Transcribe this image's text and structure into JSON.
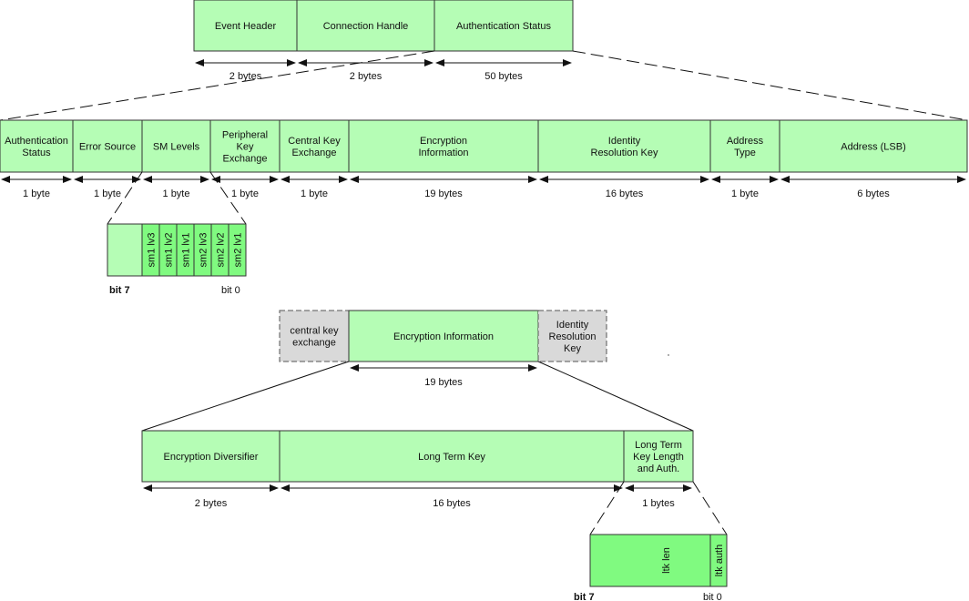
{
  "colors": {
    "field": "#b5fdb5",
    "bit_field": "#80fa80",
    "context_field": "#d9d9d9",
    "line": "#111111"
  },
  "event_packet": {
    "fields": [
      {
        "label": "Event Header",
        "size": "2 bytes"
      },
      {
        "label": "Connection Handle",
        "size": "2 bytes"
      },
      {
        "label": "Authentication Status",
        "size": "50 bytes"
      }
    ]
  },
  "authentication_status": {
    "fields": [
      {
        "label": "Authentication\nStatus",
        "size": "1 byte"
      },
      {
        "label": "Error Source",
        "size": "1 byte"
      },
      {
        "label": "SM Levels",
        "size": "1 byte"
      },
      {
        "label": "Peripheral\nKey\nExchange",
        "size": "1 byte"
      },
      {
        "label": "Central Key\nExchange",
        "size": "1 byte"
      },
      {
        "label": "Encryption\nInformation",
        "size": "19 bytes"
      },
      {
        "label": "Identity\nResolution Key",
        "size": "16 bytes"
      },
      {
        "label": "Address\nType",
        "size": "1 byte"
      },
      {
        "label": "Address (LSB)",
        "size": "6 bytes"
      }
    ]
  },
  "sm_levels_bits": {
    "bits": [
      "",
      "sm1 lv3",
      "sm1 lv2",
      "sm1 lv1",
      "sm2 lv3",
      "sm2 lv2",
      "sm2 lv1"
    ],
    "msb_label": "bit 7",
    "lsb_label": "bit 0"
  },
  "encryption_context": {
    "fields": [
      {
        "label": "central key\nexchange",
        "style": "context"
      },
      {
        "label": "Encryption Information",
        "style": "field"
      },
      {
        "label": "Identity\nResolution\nKey",
        "style": "context"
      }
    ],
    "size": "19 bytes"
  },
  "encryption_information": {
    "fields": [
      {
        "label": "Encryption Diversifier",
        "size": "2 bytes"
      },
      {
        "label": "Long Term Key",
        "size": "16 bytes"
      },
      {
        "label": "Long Term\nKey Length\nand Auth.",
        "size": "1 bytes"
      }
    ]
  },
  "ltk_bits": {
    "bits": [
      "ltk len",
      "ltk auth"
    ],
    "msb_label": "bit 7",
    "lsb_label": "bit 0"
  }
}
